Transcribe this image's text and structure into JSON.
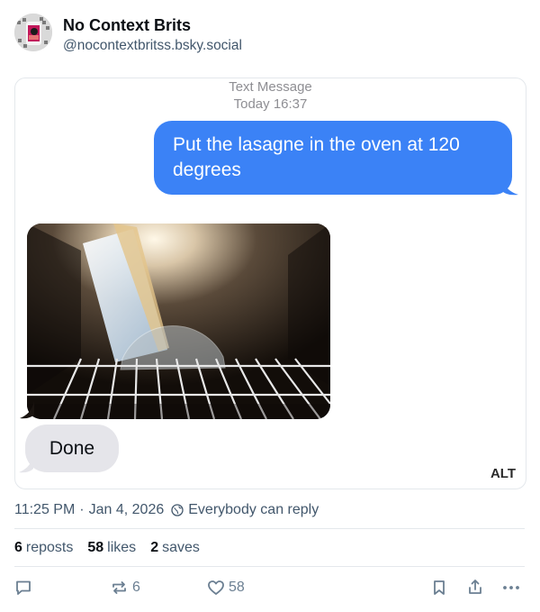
{
  "author": {
    "display_name": "No Context Brits",
    "handle": "@nocontextbritss.bsky.social",
    "avatar_icon": "avatar-image"
  },
  "media": {
    "message_label": "Text Message",
    "message_time": "Today 16:37",
    "outgoing_text": "Put the lasagne in the oven at 120 degrees",
    "incoming_text": "Done",
    "photo_icon": "lasagne-on-protractor-photo",
    "alt_label": "ALT",
    "colors": {
      "outgoing": "#3b82f6",
      "incoming": "#e5e5ea"
    }
  },
  "meta": {
    "time": "11:25 PM",
    "separator": "·",
    "date": "Jan 4, 2026",
    "reply_setting": "Everybody can reply",
    "reply_icon": "globe-icon"
  },
  "stats": {
    "reposts_count": "6",
    "reposts_label": "reposts",
    "likes_count": "58",
    "likes_label": "likes",
    "saves_count": "2",
    "saves_label": "saves"
  },
  "actions": {
    "reply_icon": "comment-icon",
    "repost_icon": "repost-icon",
    "repost_count": "6",
    "like_icon": "heart-icon",
    "like_count": "58",
    "bookmark_icon": "bookmark-icon",
    "share_icon": "share-icon",
    "more_icon": "more-icon"
  }
}
